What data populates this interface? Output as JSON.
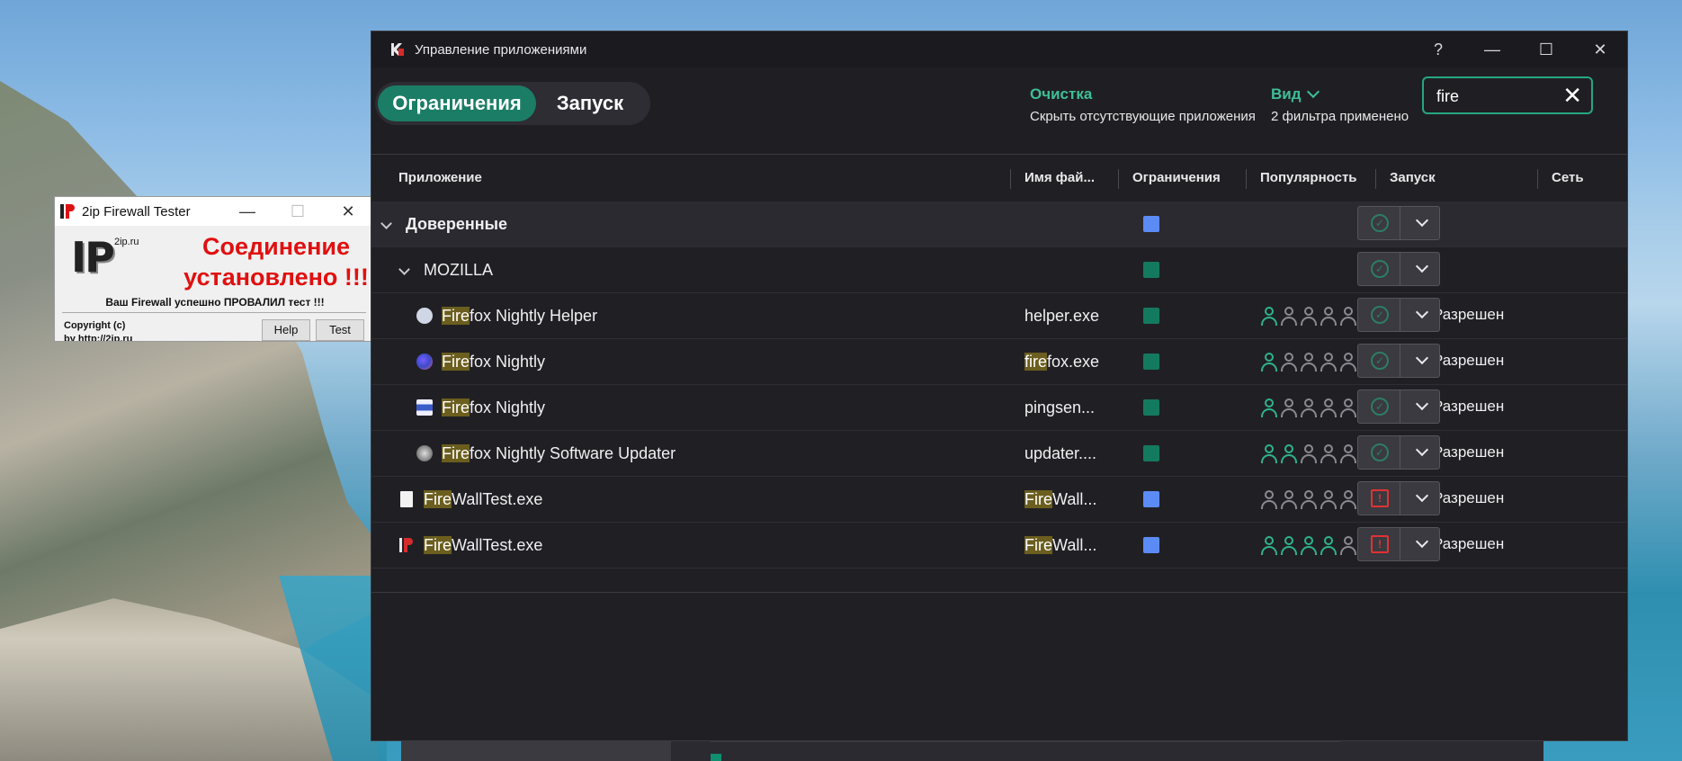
{
  "tester": {
    "title": "2ip Firewall Tester",
    "logo_letters": "IP",
    "site_small": "2ip.ru",
    "message": "Соединение установлено !!!",
    "result": "Ваш Firewall успешно ПРОВАЛИЛ тест !!!",
    "copyright_line1": "Copyright (c)",
    "copyright_line2": "by http://2ip.ru",
    "help_label": "Help",
    "test_label": "Test",
    "min": "—",
    "max": "☐",
    "close": "✕"
  },
  "app": {
    "title": "Управление приложениями",
    "help": "?",
    "minimize": "—",
    "maximize": "☐",
    "close": "✕",
    "tabs": {
      "active": "Ограничения",
      "inactive": "Запуск"
    },
    "filter_clean": {
      "heading": "Очистка",
      "sub": "Скрыть отсутствующие приложения"
    },
    "filter_view": {
      "heading": "Вид",
      "sub": "2 фильтра применено"
    },
    "search": {
      "value": "fire",
      "clear": "✕"
    },
    "columns": {
      "app": "Приложение",
      "file": "Имя фай...",
      "restrictions": "Ограничения",
      "popularity": "Популярность",
      "launch": "Запуск",
      "network": "Сеть"
    },
    "groups": {
      "trusted": "Доверенные",
      "vendor": "MOZILLA"
    },
    "rows": [
      {
        "hl": "Fire",
        "name": "fox Nightly Helper",
        "file_hl": "",
        "file": "helper.exe",
        "pop": 1,
        "launch": "Разрешен"
      },
      {
        "hl": "Fire",
        "name": "fox Nightly",
        "file_hl": "fire",
        "file": "fox.exe",
        "pop": 1,
        "launch": "Разрешен"
      },
      {
        "hl": "Fire",
        "name": "fox Nightly",
        "file_hl": "",
        "file": "pingsen...",
        "pop": 1,
        "launch": "Разрешен"
      },
      {
        "hl": "Fire",
        "name": "fox Nightly Software Updater",
        "file_hl": "",
        "file": "updater....",
        "pop": 2,
        "launch": "Разрешен"
      },
      {
        "hl": "Fire",
        "name": "WallTest.exe",
        "file_hl": "Fire",
        "file": "Wall...",
        "pop": 0,
        "launch": "Разрешен"
      },
      {
        "hl": "Fire",
        "name": "WallTest.exe",
        "file_hl": "Fire",
        "file": "Wall...",
        "pop": 4,
        "launch": "Разрешен"
      }
    ]
  },
  "colors": {
    "accent": "#1b7d65",
    "link": "#3fbf95",
    "restriction_blue": "#5b8cf5",
    "restriction_green": "#137a60",
    "warning": "#e23232",
    "highlight": "#6b5e1e"
  }
}
